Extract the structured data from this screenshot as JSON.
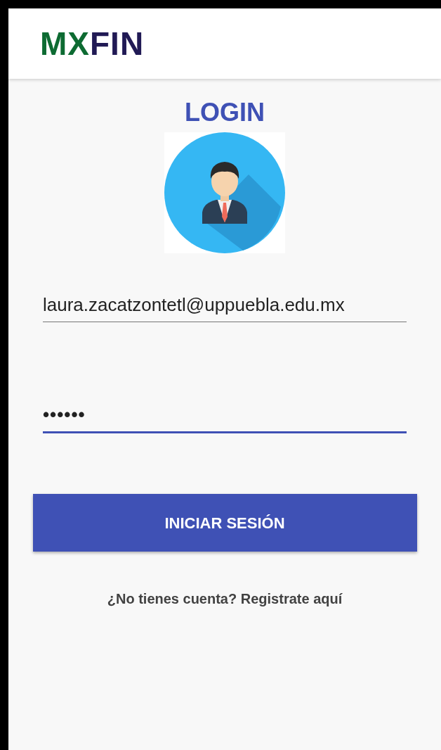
{
  "app_bar": {
    "logo": [
      {
        "text": "MX",
        "color": "#0d6b32"
      },
      {
        "text": "FIN",
        "color": "#211a55"
      }
    ]
  },
  "title": "LOGIN",
  "fields": [
    {
      "value": "laura.zacatzontetl@uppuebla.edu.mx",
      "focused": false
    },
    {
      "value": "••••••",
      "focused": true
    }
  ],
  "login_button": "INICIAR SESIÓN",
  "register_link": "¿No tienes cuenta? Registrate aquí"
}
